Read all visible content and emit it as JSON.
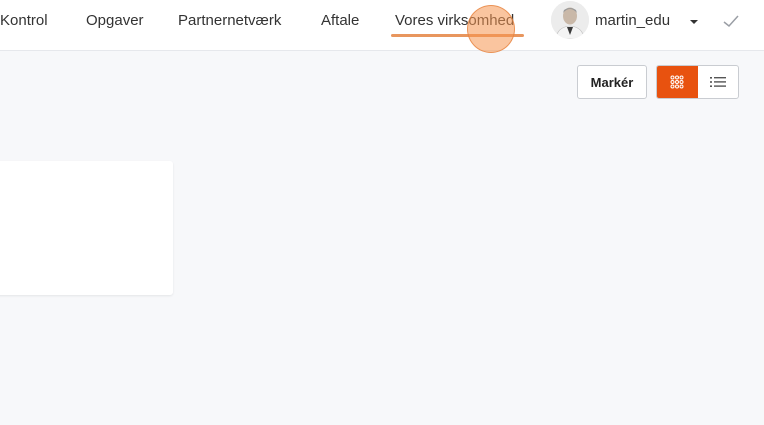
{
  "nav": {
    "items": [
      {
        "label": "Kontrol"
      },
      {
        "label": "Opgaver"
      },
      {
        "label": "Partnernetværk"
      },
      {
        "label": "Aftale"
      },
      {
        "label": "Vores virksomhed"
      }
    ],
    "active": "Vores virksomhed"
  },
  "user": {
    "name": "martin_edu",
    "avatar_icon": "user-avatar-photo"
  },
  "toolbar": {
    "mark_label": "Markér",
    "view_modes": [
      {
        "icon": "grid-icon",
        "active": true
      },
      {
        "icon": "list-icon",
        "active": false
      }
    ]
  },
  "colors": {
    "accent": "#e8520f",
    "nav_underline": "#e8965e",
    "background": "#f7f8fa"
  }
}
